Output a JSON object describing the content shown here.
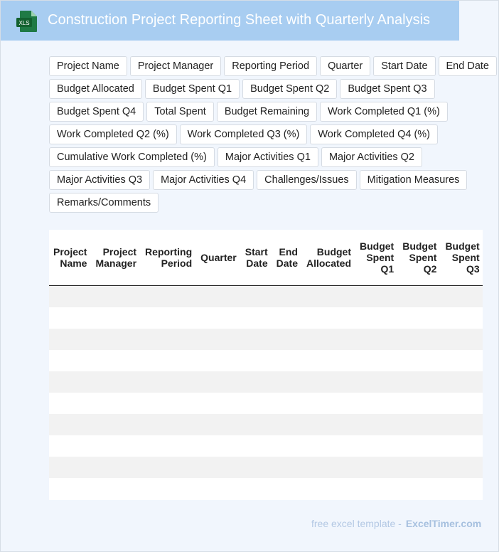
{
  "header": {
    "title": "Construction Project Reporting Sheet with Quarterly Analysis",
    "file_icon": "xls-file-icon",
    "file_icon_text": "XLS",
    "accent": "#a8cdf1",
    "icon_color": "#1f7a45"
  },
  "fields": [
    "Project Name",
    "Project Manager",
    "Reporting Period",
    "Quarter",
    "Start Date",
    "End Date",
    "Budget Allocated",
    "Budget Spent Q1",
    "Budget Spent Q2",
    "Budget Spent Q3",
    "Budget Spent Q4",
    "Total Spent",
    "Budget Remaining",
    "Work Completed Q1 (%)",
    "Work Completed Q2 (%)",
    "Work Completed Q3 (%)",
    "Work Completed Q4 (%)",
    "Cumulative Work Completed (%)",
    "Major Activities Q1",
    "Major Activities Q2",
    "Major Activities Q3",
    "Major Activities Q4",
    "Challenges/Issues",
    "Mitigation Measures",
    "Remarks/Comments"
  ],
  "table": {
    "columns": [
      "Project Name",
      "Project Manager",
      "Reporting Period",
      "Quarter",
      "Start Date",
      "End Date",
      "Budget Allocated",
      "Budget Spent Q1",
      "Budget Spent Q2",
      "Budget Spent Q3"
    ],
    "row_count": 10
  },
  "footer": {
    "lead": "free excel template -",
    "brand": "ExcelTimer.com"
  }
}
